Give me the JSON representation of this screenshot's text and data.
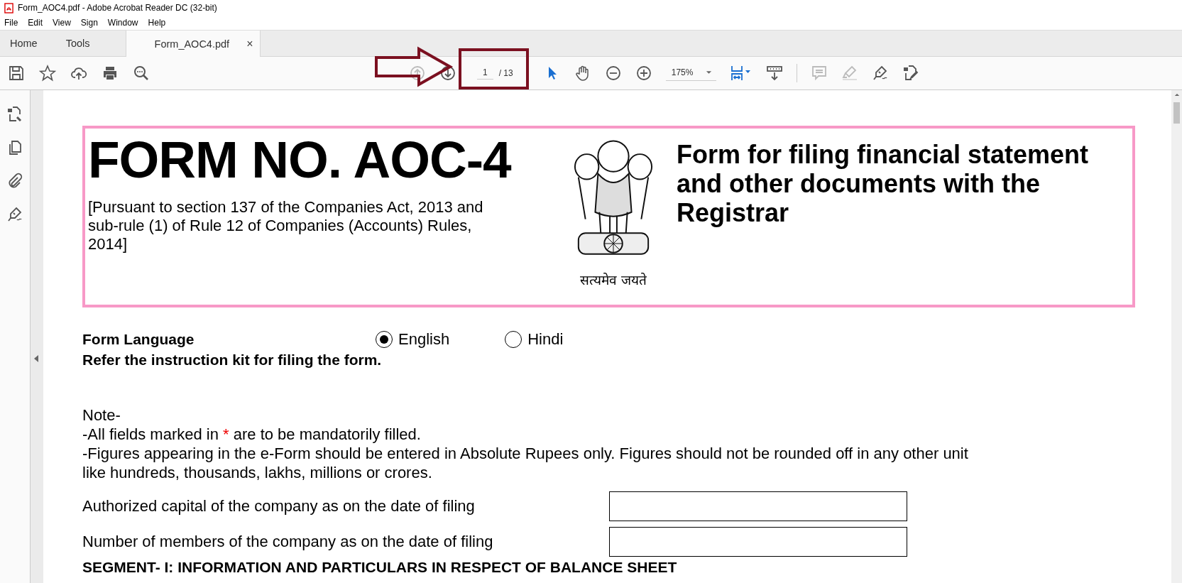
{
  "window": {
    "title": "Form_AOC4.pdf - Adobe Acrobat Reader DC (32-bit)"
  },
  "menu": [
    "File",
    "Edit",
    "View",
    "Sign",
    "Window",
    "Help"
  ],
  "tabs": [
    {
      "label": "Home",
      "selected": false
    },
    {
      "label": "Tools",
      "selected": false
    },
    {
      "label": "Form_AOC4.pdf",
      "selected": true,
      "close": "×"
    }
  ],
  "toolbar": {
    "page_field": {
      "value": "1",
      "total": "/ 13"
    },
    "zoom": {
      "value": "175%"
    }
  },
  "document": {
    "title": "FORM NO. AOC-4",
    "citation": "[Pursuant to section 137 of the Companies Act, 2013 and sub-rule (1) of Rule 12 of Companies (Accounts) Rules, 2014]",
    "motto": "सत्यमेव जयते",
    "heading": "Form for filing financial statement and other documents with the Registrar",
    "language": {
      "label": "Form Language",
      "options": [
        {
          "label": "English",
          "selected": true
        },
        {
          "label": "Hindi",
          "selected": false
        }
      ]
    },
    "instruction": "Refer the instruction kit for filing the form.",
    "note": {
      "title": "Note-",
      "mandatory": {
        "before": "-All fields marked in",
        "mark": "*",
        "after": "are to be mandatorily filled."
      },
      "figures": "-Figures appearing in the e-Form should be entered in Absolute Rupees only. Figures should not be rounded off in any other unit like hundreds, thousands, lakhs, millions or crores."
    },
    "fields": [
      {
        "label": "Authorized capital of the company as on the date of filing"
      },
      {
        "label": "Number of members of the company as on the date of filing"
      }
    ],
    "segment": "SEGMENT- I: INFORMATION AND PARTICULARS IN RESPECT OF BALANCE SHEET"
  }
}
